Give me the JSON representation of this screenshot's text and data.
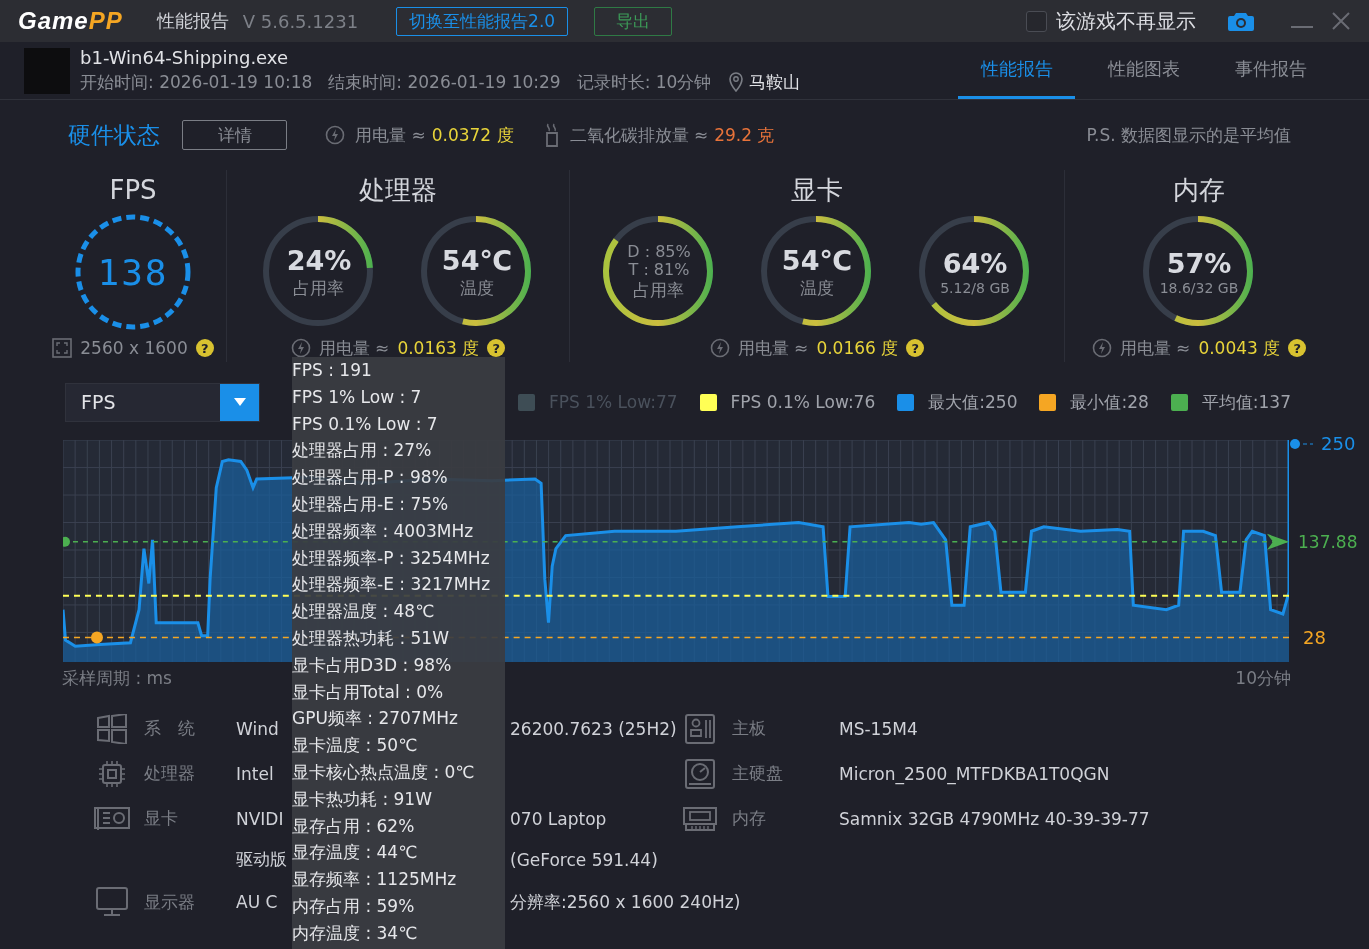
{
  "app": {
    "logo_a": "Game",
    "logo_b": "PP",
    "title": "性能报告",
    "version": "V 5.6.5.1231"
  },
  "header_buttons": [
    {
      "label": "切换至性能报告2.0",
      "kind": "switch"
    },
    {
      "label": "导出",
      "kind": "export"
    }
  ],
  "hide_game": {
    "label": "该游戏不再显示",
    "checked": false
  },
  "session": {
    "exe": "b1-Win64-Shipping.exe",
    "start": "开始时间: 2026-01-19 10:18",
    "end": "结束时间: 2026-01-19 10:29",
    "duration": "记录时长: 10分钟",
    "location": "马鞍山"
  },
  "tabs": [
    {
      "label": "性能报告",
      "selected": true
    },
    {
      "label": "性能图表",
      "selected": false
    },
    {
      "label": "事件报告",
      "selected": false
    }
  ],
  "hardware": {
    "title": "硬件状态",
    "details_button": "详情",
    "power_label": "用电量 ≈",
    "power_value": "0.0372 度",
    "co2_label": "二氧化碳排放量 ≈",
    "co2_value": "29.2 克",
    "note": "P.S. 数据图显示的是平均值"
  },
  "gauges": [
    {
      "title": "FPS",
      "kind": "fps",
      "value": "138",
      "footer": {
        "kind": "resolution",
        "text": "2560 x 1600",
        "help": "?"
      }
    },
    {
      "title": "处理器",
      "kind": "rings",
      "rings": [
        {
          "kind": "big",
          "main": "24%",
          "caption": "占用率",
          "level": 0.24
        },
        {
          "kind": "big",
          "main": "54℃",
          "caption": "温度",
          "level": 0.54
        }
      ],
      "footer": {
        "kind": "power",
        "label": "用电量 ≈",
        "text": "0.0163 度",
        "help": "?"
      }
    },
    {
      "title": "显卡",
      "kind": "rings",
      "rings": [
        {
          "kind": "dual",
          "lines": [
            "D : 85%",
            "T : 81%"
          ],
          "caption": "占用率",
          "level": 0.85
        },
        {
          "kind": "big",
          "main": "54℃",
          "caption": "温度",
          "level": 0.54
        },
        {
          "kind": "big",
          "main": "64%",
          "caption": "5.12/8 GB",
          "level": 0.64
        }
      ],
      "footer": {
        "kind": "power",
        "label": "用电量 ≈",
        "text": "0.0166 度",
        "help": "?"
      }
    },
    {
      "title": "内存",
      "kind": "rings",
      "rings": [
        {
          "kind": "big",
          "main": "57%",
          "caption": "18.6/32 GB",
          "level": 0.57
        }
      ],
      "footer": {
        "kind": "power",
        "label": "用电量 ≈",
        "text": "0.0043 度",
        "help": "?"
      }
    }
  ],
  "chart": {
    "dropdown": "FPS",
    "legend": [
      {
        "label": "FPS 1% Low:77",
        "color": "#3e4d55",
        "on": false
      },
      {
        "label": "FPS 0.1% Low:76",
        "color": "#ffff55",
        "on": true
      },
      {
        "label": "最大值:250",
        "color": "#1a8fe8",
        "on": true
      },
      {
        "label": "最小值:28",
        "color": "#f5a623",
        "on": true
      },
      {
        "label": "平均值:137",
        "color": "#4caf50",
        "on": true
      }
    ],
    "max_label": "250",
    "avg_label": "137.88",
    "min_label": "28",
    "x_left": "采样周期 : ms",
    "x_right": "10分钟"
  },
  "tooltip": [
    "FPS : 191",
    "FPS 1% Low : 7",
    "FPS 0.1% Low : 7",
    "处理器占用 : 27%",
    "处理器占用-P : 98%",
    "处理器占用-E : 75%",
    "处理器频率 : 4003MHz",
    "处理器频率-P : 3254MHz",
    "处理器频率-E : 3217MHz",
    "处理器温度 : 48℃",
    "处理器热功耗 : 51W",
    "显卡占用D3D : 98%",
    "显卡占用Total : 0%",
    "GPU频率 : 2707MHz",
    "显卡温度 : 50℃",
    "显卡核心热点温度 : 0℃",
    "显卡热功耗 : 91W",
    "显存占用 : 62%",
    "显存温度 : 44℃",
    "显存频率 : 1125MHz",
    "内存占用 : 59%",
    "内存温度 : 34℃"
  ],
  "system_left": [
    {
      "kind": "os",
      "label": "系　统",
      "lead": "Wind",
      "tail": "26200.7623 (25H2)"
    },
    {
      "kind": "cpu",
      "label": "处理器",
      "lead": "Intel"
    },
    {
      "kind": "gpu",
      "label": "显卡",
      "lead": "NVIDI",
      "tail": "070 Laptop"
    },
    {
      "kind": "driver",
      "lead": "驱动版",
      "tail": "(GeForce 591.44)"
    },
    {
      "kind": "display",
      "label": "显示器",
      "lead": "AU C",
      "tail": "分辨率:2560 x 1600 240Hz)"
    }
  ],
  "system_right": [
    {
      "kind": "board",
      "label": "主板",
      "value": "MS-15M4"
    },
    {
      "kind": "disk",
      "label": "主硬盘",
      "value": "Micron_2500_MTFDKBA1T0QGN"
    },
    {
      "kind": "memory",
      "label": "内存",
      "value": "Samnix 32GB 4790MHz 40-39-39-77"
    }
  ]
}
